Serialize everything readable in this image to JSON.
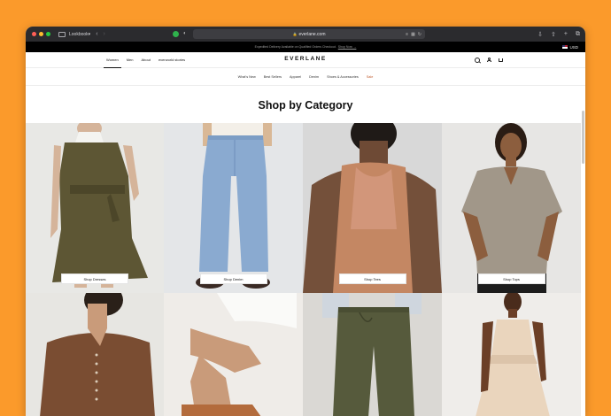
{
  "browser": {
    "tab_group_label": "Lookbook▾",
    "url": "everlane.com"
  },
  "announcement": {
    "text": "Expedited Delivery Available on Qualified Orders Checkout.",
    "link": "Shop Now →",
    "currency": "USD"
  },
  "nav": {
    "primary": [
      "Women",
      "Men",
      "About",
      "everworld stories"
    ],
    "logo": "EVERLANE"
  },
  "subnav": [
    "What's New",
    "Best Sellers",
    "Apparel",
    "Denim",
    "Shoes & Accessories",
    "Sale"
  ],
  "page": {
    "title": "Shop by Category"
  },
  "categories": [
    {
      "button": "Shop Dresses"
    },
    {
      "button": "Shop Denim"
    },
    {
      "button": "Shop Tees"
    },
    {
      "button": "Shop Tops"
    }
  ],
  "colors": {
    "background": "#fb9a2b",
    "chrome": "#2b2b2e",
    "announcement_bar": "#000000",
    "sale": "#c05c2e"
  }
}
